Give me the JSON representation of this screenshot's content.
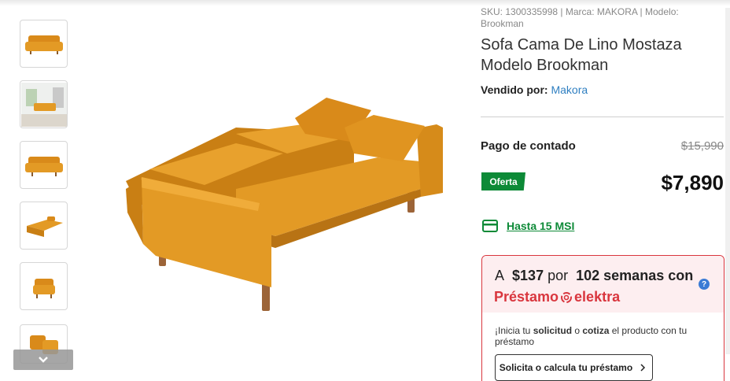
{
  "thumbnails": [
    {
      "label": "sofa-front"
    },
    {
      "label": "sofa-in-room"
    },
    {
      "label": "sofa-angle"
    },
    {
      "label": "sofa-bed-open"
    },
    {
      "label": "sofa-side"
    },
    {
      "label": "sofa-detail"
    }
  ],
  "product": {
    "sku_line": "SKU: 1300335998 | Marca: MAKORA | Modelo: Brookman",
    "title": "Sofa Cama De Lino Mostaza Modelo Brookman",
    "seller_label": "Vendido por:",
    "seller_name": "Makora"
  },
  "pricing": {
    "label": "Pago de contado",
    "old_price": "$15,990",
    "badge": "Oferta",
    "price": "$7,890",
    "msi": "Hasta 15 MSI"
  },
  "loan": {
    "prefix": "A",
    "amount": "$137",
    "per": "por",
    "weeks": "102 semanas con",
    "brand_left": "Préstamo",
    "brand_right": "elektra",
    "text_start": "¡Inicia tu ",
    "text_bold1": "solicitud",
    "text_mid": " o ",
    "text_bold2": "cotiza",
    "text_end": " el producto con tu préstamo",
    "button": "Solicita o calcula tu préstamo"
  },
  "colors": {
    "accent_green": "#0d8a37",
    "accent_red": "#d9363e",
    "link_blue": "#2f7fc1",
    "sofa": "#e0951f"
  }
}
